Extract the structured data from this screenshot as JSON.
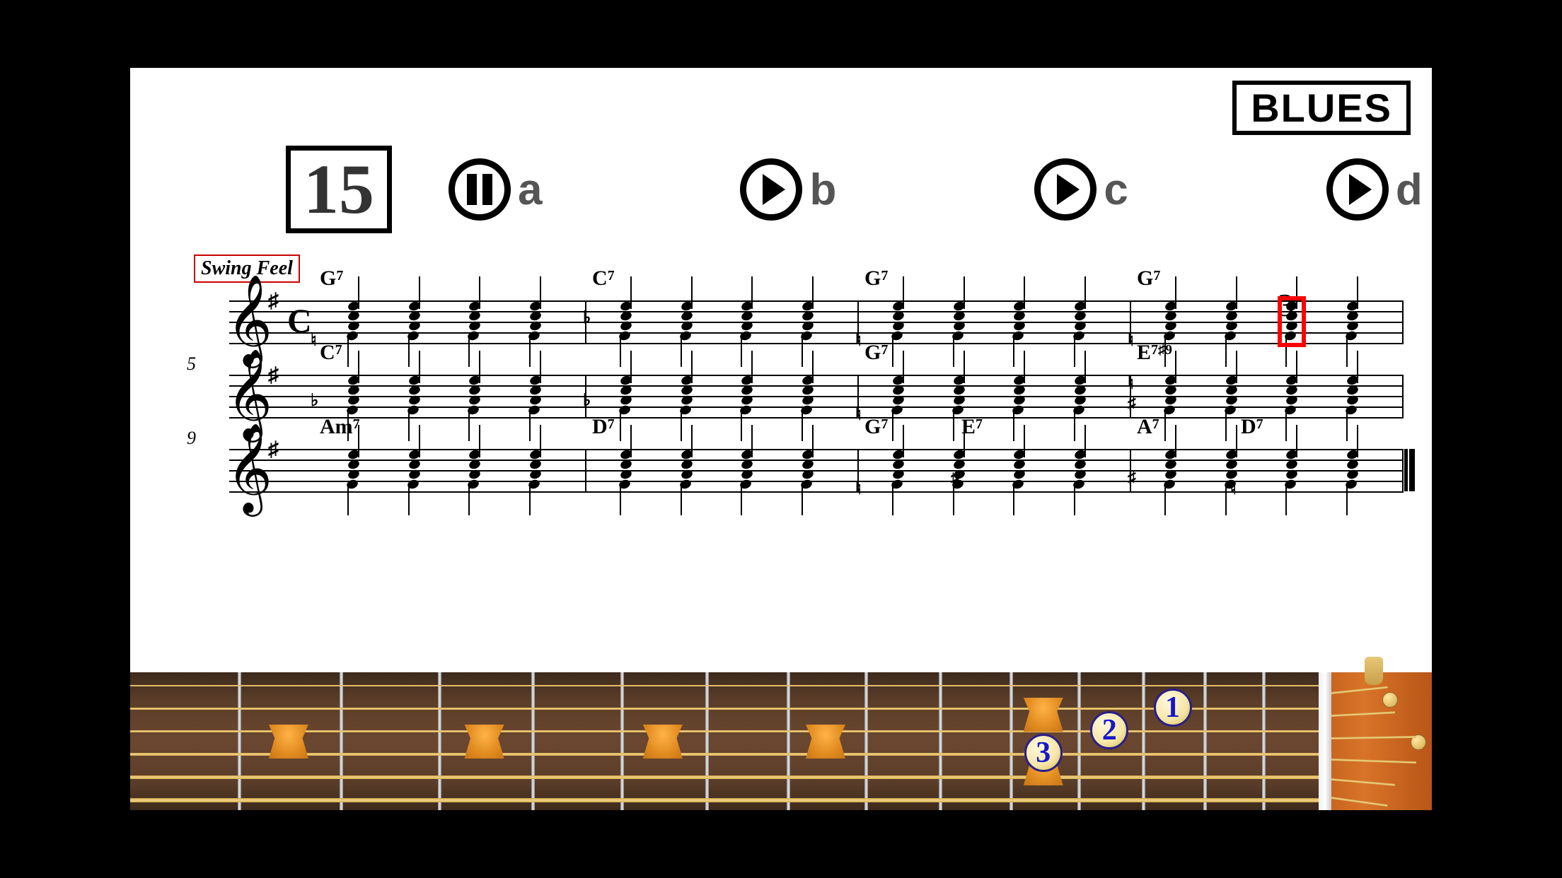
{
  "style_label": "BLUES",
  "exercise_number": "15",
  "variants": [
    {
      "label": "a",
      "state": "pause"
    },
    {
      "label": "b",
      "state": "play"
    },
    {
      "label": "c",
      "state": "play"
    },
    {
      "label": "d",
      "state": "play"
    }
  ],
  "feel_label": "Swing Feel",
  "beat_counter": "3",
  "systems": [
    {
      "bar_num": "",
      "show_time_sig": true,
      "measures": [
        {
          "chords": [
            {
              "pos": 8,
              "txt": "G",
              "ext": "7"
            }
          ],
          "accidentals": [
            {
              "pos": -5,
              "y": 42,
              "sym": "♮"
            }
          ]
        },
        {
          "chords": [
            {
              "pos": 8,
              "txt": "C",
              "ext": "7"
            }
          ],
          "accidentals": [
            {
              "pos": -5,
              "y": 10,
              "sym": "♭"
            }
          ]
        },
        {
          "chords": [
            {
              "pos": 8,
              "txt": "G",
              "ext": "7"
            }
          ],
          "accidentals": [
            {
              "pos": -5,
              "y": 42,
              "sym": "♮"
            }
          ]
        },
        {
          "chords": [
            {
              "pos": 8,
              "txt": "G",
              "ext": "7"
            }
          ],
          "accidentals": [
            {
              "pos": -5,
              "y": 42,
              "sym": "♮"
            }
          ],
          "highlight_beat": 2
        }
      ]
    },
    {
      "bar_num": "5",
      "show_time_sig": false,
      "measures": [
        {
          "chords": [
            {
              "pos": 8,
              "txt": "C",
              "ext": "7"
            }
          ],
          "accidentals": [
            {
              "pos": -5,
              "y": 22,
              "sym": "♭"
            }
          ]
        },
        {
          "chords": [],
          "accidentals": [
            {
              "pos": -5,
              "y": 22,
              "sym": "♭"
            }
          ]
        },
        {
          "chords": [
            {
              "pos": 8,
              "txt": "G",
              "ext": "7"
            }
          ],
          "accidentals": [
            {
              "pos": -5,
              "y": 42,
              "sym": "♮"
            }
          ]
        },
        {
          "chords": [
            {
              "pos": 8,
              "txt": "E",
              "ext": "7♯9"
            }
          ],
          "accidentals": [
            {
              "pos": -5,
              "y": 28,
              "sym": "♯"
            },
            {
              "pos": -5,
              "y": -2,
              "sym": "♮"
            }
          ]
        }
      ]
    },
    {
      "bar_num": "9",
      "show_time_sig": false,
      "final": true,
      "measures": [
        {
          "chords": [
            {
              "pos": 8,
              "txt": "Am",
              "ext": "7"
            }
          ],
          "accidentals": []
        },
        {
          "chords": [
            {
              "pos": 8,
              "txt": "D",
              "ext": "7"
            }
          ],
          "accidentals": []
        },
        {
          "chords": [
            {
              "pos": 8,
              "txt": "G",
              "ext": "7"
            },
            {
              "pos": 145,
              "txt": "E",
              "ext": "7"
            }
          ],
          "accidentals": [
            {
              "pos": -5,
              "y": 42,
              "sym": "♮"
            },
            {
              "pos": 130,
              "y": 28,
              "sym": "♯"
            }
          ]
        },
        {
          "chords": [
            {
              "pos": 8,
              "txt": "A",
              "ext": "7"
            },
            {
              "pos": 155,
              "txt": "D",
              "ext": "7"
            }
          ],
          "accidentals": [
            {
              "pos": -5,
              "y": 28,
              "sym": "♯"
            },
            {
              "pos": 140,
              "y": 42,
              "sym": "♮"
            }
          ]
        }
      ]
    }
  ],
  "fretboard": {
    "num_frets": 15,
    "inlays_at": [
      2,
      4,
      6,
      8,
      11
    ],
    "double_inlay": 11,
    "fingers": [
      {
        "fret": 13,
        "string": 2,
        "num": "1"
      },
      {
        "fret": 12,
        "string": 3,
        "num": "2"
      },
      {
        "fret": 11,
        "string": 4,
        "num": "3"
      }
    ]
  }
}
